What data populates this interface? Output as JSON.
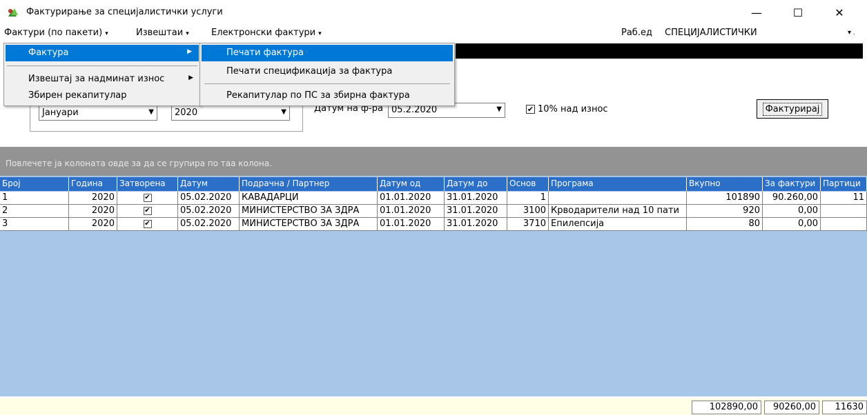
{
  "window": {
    "title": "Фактурирање за специјалистички услуги",
    "min": "—",
    "max": "☐",
    "close": "✕"
  },
  "menubar": {
    "items": [
      {
        "label": "Фактури (по пакети)"
      },
      {
        "label": "Извештаи"
      },
      {
        "label": "Електронски фактури"
      }
    ],
    "arrow": "▾",
    "rab_label": "Раб.ед",
    "rab_value": "СПЕЦИЈАЛИСТИЧКИ",
    "rab_arrow": "▾ ."
  },
  "menu_level1": {
    "items": [
      {
        "label": "Фактура",
        "submenu": "▶"
      },
      {
        "label": "Извештај за надминат износ",
        "submenu": "▶"
      },
      {
        "label": "Збирен рекапитулар"
      }
    ]
  },
  "menu_level2": {
    "items": [
      {
        "label": "Печати фактура"
      },
      {
        "label": "Печати спецификација за фактура"
      },
      {
        "label": "Рекапитулар по ПС за збирна фактура"
      }
    ]
  },
  "filters": {
    "month": "Јануари",
    "year": "2020",
    "date_label": "Датум на ф-ра",
    "date_value": "05.2.2020",
    "dropdown_arrow": "▼",
    "checkbox_checked": "✔",
    "checkbox_label": "10% над износ",
    "button_label": "Фактурирај"
  },
  "grid": {
    "group_hint": "Повлечете ја колоната овде за да се групира по таа колона.",
    "columns": [
      "Број",
      "Година",
      "Затворена",
      "Датум",
      "Подрачна / Партнер",
      "Датум од",
      "Датум до",
      "Основ",
      "Програма",
      "Вкупно",
      "За фактури",
      "Партици"
    ],
    "rows": [
      [
        "1",
        "2020",
        "✔",
        "05.02.2020",
        "КАВАДАРЦИ",
        "01.01.2020",
        "31.01.2020",
        "1",
        "",
        "101890",
        "90.260,00",
        "11"
      ],
      [
        "2",
        "2020",
        "✔",
        "05.02.2020",
        "МИНИСТЕРСТВО ЗА ЗДРА",
        "01.01.2020",
        "31.01.2020",
        "3100",
        "Крводарители над 10 пати",
        "920",
        "0,00",
        ""
      ],
      [
        "3",
        "2020",
        "✔",
        "05.02.2020",
        "МИНИСТЕРСТВО ЗА ЗДРА",
        "01.01.2020",
        "31.01.2020",
        "3710",
        "Епилепсија",
        "80",
        "0,00",
        ""
      ]
    ],
    "totals": [
      "102890,00",
      "90260,00",
      "11630"
    ]
  },
  "icons": {
    "app": "app-leaf-icon"
  },
  "colors": {
    "header_bg": "#2b6fc9",
    "grid_bg": "#a7c6e8",
    "menu_highlight": "#0078d7",
    "footer_bg": "#ffffe6"
  }
}
